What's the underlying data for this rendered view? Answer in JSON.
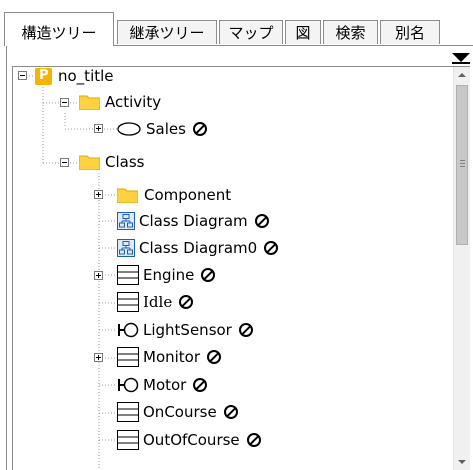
{
  "tabs": [
    {
      "label": "構造ツリー",
      "active": true
    },
    {
      "label": "継承ツリー",
      "active": false
    },
    {
      "label": "マップ",
      "active": false
    },
    {
      "label": "図",
      "active": false
    },
    {
      "label": "検索",
      "active": false
    },
    {
      "label": "別名",
      "active": false
    }
  ],
  "tree": {
    "root": {
      "badge": "P",
      "label": "no_title"
    },
    "activity_folder": {
      "label": "Activity"
    },
    "sales": {
      "label": "Sales"
    },
    "class_folder": {
      "label": "Class"
    },
    "component_folder": {
      "label": "Component"
    },
    "class_diagram": {
      "label": "Class Diagram"
    },
    "class_diagram0": {
      "label": "Class Diagram0"
    },
    "engine": {
      "label": "Engine"
    },
    "idle": {
      "label": "Idle"
    },
    "light_sensor": {
      "label": "LightSensor"
    },
    "monitor": {
      "label": "Monitor"
    },
    "motor": {
      "label": "Motor"
    },
    "on_course": {
      "label": "OnCourse"
    },
    "out_of_course": {
      "label": "OutOfCourse"
    }
  },
  "icons": {
    "folder_color": "#ffd23f",
    "project_badge_color": "#f4b400",
    "diagram_color": "#1e5eb8"
  }
}
